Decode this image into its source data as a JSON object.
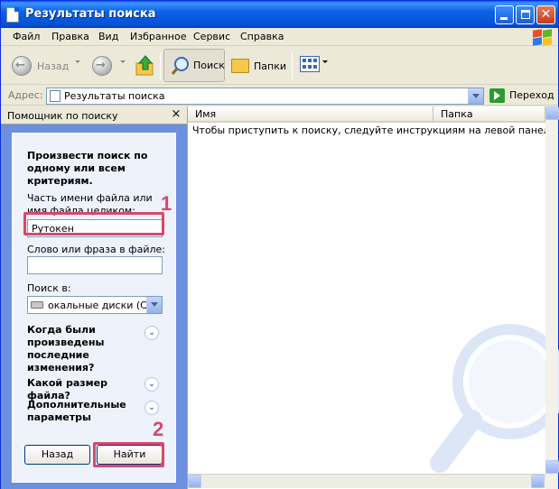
{
  "window": {
    "title": "Результаты поиска"
  },
  "menu": {
    "items": [
      "Файл",
      "Правка",
      "Вид",
      "Избранное",
      "Сервис",
      "Справка"
    ]
  },
  "toolbar": {
    "back_label": "Назад",
    "search_label": "Поиск",
    "folders_label": "Папки"
  },
  "address": {
    "label": "Адрес:",
    "value": "Результаты поиска",
    "go_label": "Переход"
  },
  "search_panel": {
    "header": "Помощник по поиску",
    "close_glyph": "×",
    "heading": "Произвести поиск по одному или всем критериям.",
    "filename_label": "Часть имени файла или имя файла целиком:",
    "filename_value": "Рутокен",
    "phrase_label": "Слово или фраза в файле:",
    "phrase_value": "",
    "lookin_label": "Поиск в:",
    "lookin_value": "окальные диски (C:)",
    "section_when": "Когда были произведены последние изменения?",
    "section_size": "Какой размер файла?",
    "section_more": "Дополнительные параметры",
    "back_button": "Назад",
    "find_button": "Найти"
  },
  "results": {
    "columns": [
      "Имя",
      "Папка"
    ],
    "hint": "Чтобы приступить к поиску, следуйте инструкциям на левой панели."
  },
  "callouts": [
    "1",
    "2"
  ],
  "colors": {
    "title_bar": "#0a5fe0",
    "panel_blue": "#6d8fe0",
    "callout": "#d8486a"
  },
  "icons": {
    "title": "folder-search-icon",
    "back": "back-arrow-icon",
    "forward": "forward-arrow-icon",
    "up": "folder-up-icon",
    "search": "magnifier-icon",
    "folders": "folders-icon",
    "views": "views-icon",
    "go": "go-arrow-icon"
  }
}
